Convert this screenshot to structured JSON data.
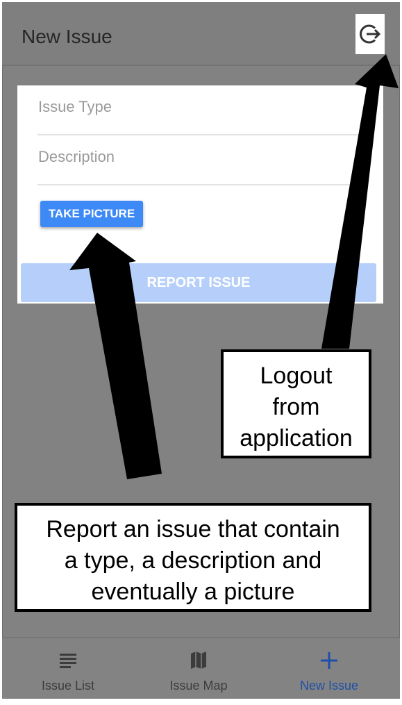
{
  "header": {
    "title": "New Issue",
    "logout_icon": "logout-icon"
  },
  "form": {
    "issue_type_placeholder": "Issue Type",
    "description_placeholder": "Description",
    "take_picture_label": "TAKE PICTURE",
    "report_issue_label": "REPORT ISSUE"
  },
  "nav": {
    "items": [
      {
        "label": "Issue List",
        "icon": "list-icon"
      },
      {
        "label": "Issue Map",
        "icon": "map-icon"
      },
      {
        "label": "New Issue",
        "icon": "plus-icon"
      }
    ],
    "active": "New Issue"
  },
  "annotations": {
    "logout": [
      "Logout",
      "from",
      "application"
    ],
    "report": [
      "Report an issue that contain",
      "a type, a description and",
      "eventually a picture"
    ]
  },
  "colors": {
    "accent": "#3d8af7",
    "disabled_button": "#b6cffa",
    "active_nav": "#1f4fa8",
    "overlay": "#828282"
  }
}
